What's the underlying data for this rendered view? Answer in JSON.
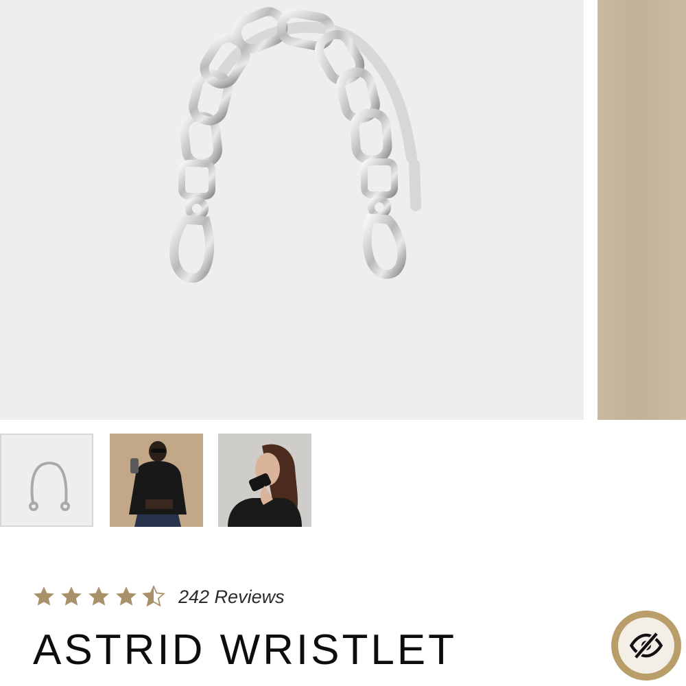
{
  "product": {
    "title": "ASTRID WRISTLET",
    "rating": 4.5,
    "rating_max": 5,
    "reviews_label": "242 Reviews"
  },
  "gallery": {
    "main_image": "silver-chain-wristlet-photo",
    "next_image": "beige-background-photo",
    "thumbnails": [
      {
        "image": "silver-chain-wristlet",
        "selected": true
      },
      {
        "image": "model-in-leather-jacket-with-phone",
        "selected": false
      },
      {
        "image": "model-holding-phone-to-ear",
        "selected": false
      }
    ]
  },
  "colors": {
    "star_gold": "#a89068",
    "privacy_ring": "#b99e6a",
    "image_background": "#efeeed"
  },
  "icons": {
    "privacy": "eye-slash-icon",
    "rating": "star-icon"
  }
}
